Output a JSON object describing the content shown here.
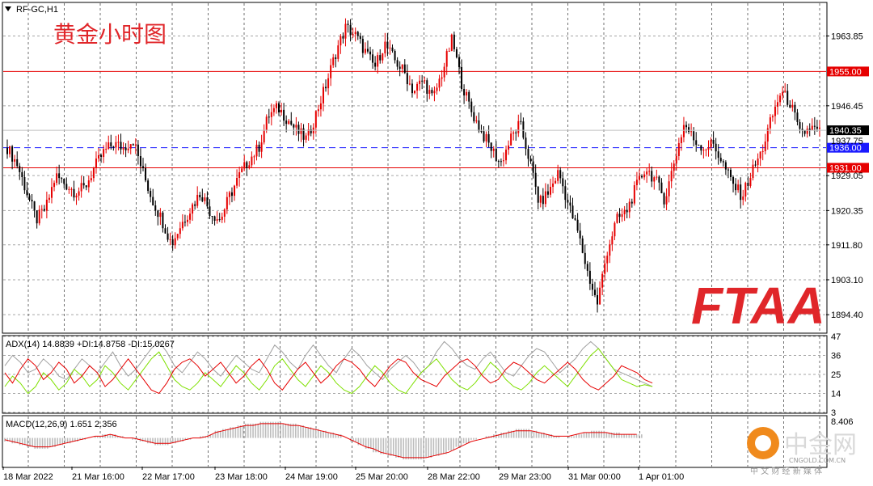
{
  "header": {
    "symbol_label": "RF-GC,H1",
    "chart_title_cn": "黄金小时图",
    "logo_text": "FTAA"
  },
  "watermark": {
    "cn_name": "中金网",
    "domain": "CNGOLD.COM.CN",
    "tagline": "中 文 财 经 新 媒 体"
  },
  "colors": {
    "bull": "#e60000",
    "bear": "#000000",
    "resistance": "#e60000",
    "support_dashed": "#1a1aff",
    "adx": "#a0a0a0",
    "plus_di": "#7fe000",
    "minus_di": "#e60000",
    "macd_hist": "#bdbdbd",
    "macd_signal": "#e60000"
  },
  "chart_data": [
    {
      "type": "candlestick",
      "name": "main",
      "y_axis_ticks": [
        "1963.85",
        "1946.45",
        "1929.05",
        "1920.35",
        "1911.80",
        "1903.10",
        "1894.40"
      ],
      "ylim": [
        1890.0,
        1972.0
      ],
      "x_tick_labels": [
        "18 Mar 2022",
        "21 Mar 16:00",
        "22 Mar 17:00",
        "23 Mar 18:00",
        "24 Mar 19:00",
        "25 Mar 20:00",
        "28 Mar 22:00",
        "29 Mar 23:00",
        "31 Mar 00:00",
        "1 Apr 01:00"
      ],
      "levels": [
        {
          "value": 1955.0,
          "label": "1955.00",
          "style": "solid",
          "color": "#e60000"
        },
        {
          "value": 1936.0,
          "label": "1936.00",
          "style": "dashed",
          "color": "#1a1aff"
        },
        {
          "value": 1931.0,
          "label": "1931.00",
          "style": "solid",
          "color": "#e60000"
        }
      ],
      "current_price": {
        "value": 1940.35,
        "label": "1940.35"
      },
      "extra_label": {
        "value": 1937.75,
        "label": "1937.75"
      },
      "path": [
        1936,
        1932,
        1925,
        1918,
        1921,
        1929,
        1927,
        1925,
        1926,
        1931,
        1935,
        1937,
        1936,
        1938,
        1930,
        1923,
        1918,
        1912,
        1917,
        1921,
        1925,
        1920,
        1918,
        1924,
        1929,
        1933,
        1936,
        1944,
        1946,
        1943,
        1940,
        1938,
        1945,
        1952,
        1960,
        1966,
        1964,
        1960,
        1956,
        1962,
        1958,
        1955,
        1950,
        1953,
        1948,
        1955,
        1963,
        1952,
        1945,
        1940,
        1936,
        1932,
        1938,
        1942,
        1933,
        1922,
        1925,
        1930,
        1922,
        1915,
        1905,
        1897,
        1910,
        1918,
        1920,
        1926,
        1931,
        1928,
        1923,
        1933,
        1942,
        1938,
        1936,
        1937,
        1932,
        1927,
        1924,
        1930,
        1935,
        1943,
        1950,
        1947,
        1939,
        1941,
        1940
      ]
    },
    {
      "type": "line",
      "name": "ADX",
      "label": "ADX(14) 14.8839 +DI:14.8758 -DI:15.0267",
      "y_axis_ticks": [
        "47",
        "36",
        "25",
        "14",
        "3"
      ],
      "ylim": [
        3,
        47
      ],
      "series": [
        {
          "name": "ADX",
          "color": "#a0a0a0",
          "values": [
            30,
            36,
            32,
            26,
            28,
            34,
            30,
            24,
            22,
            28,
            34,
            30,
            26,
            32,
            38,
            30,
            24,
            28,
            34,
            40,
            44,
            38,
            30,
            26,
            32,
            38,
            34,
            28,
            24,
            30,
            36,
            32,
            28,
            26,
            34,
            42,
            38,
            32,
            28,
            36,
            42,
            36,
            30,
            26,
            34,
            40,
            36,
            30,
            26,
            22,
            28,
            32,
            36,
            32,
            26,
            30,
            38,
            44,
            40,
            34,
            30,
            28,
            34,
            38,
            32,
            26,
            24,
            30,
            36,
            40,
            38,
            32,
            26,
            30,
            34,
            40,
            44,
            40,
            34,
            28,
            26,
            24,
            22,
            20,
            18
          ]
        },
        {
          "name": "+DI",
          "color": "#7fe000",
          "values": [
            18,
            24,
            20,
            14,
            18,
            26,
            22,
            16,
            20,
            28,
            24,
            18,
            22,
            30,
            26,
            20,
            16,
            22,
            28,
            34,
            38,
            30,
            22,
            18,
            16,
            20,
            26,
            22,
            18,
            24,
            30,
            26,
            20,
            16,
            22,
            30,
            34,
            28,
            22,
            18,
            24,
            30,
            26,
            20,
            16,
            14,
            18,
            24,
            30,
            26,
            20,
            16,
            14,
            20,
            26,
            30,
            34,
            28,
            22,
            18,
            16,
            20,
            26,
            32,
            28,
            22,
            18,
            16,
            20,
            26,
            30,
            26,
            22,
            18,
            24,
            30,
            36,
            40,
            34,
            28,
            22,
            20,
            18,
            19,
            18
          ]
        },
        {
          "name": "-DI",
          "color": "#e60000",
          "values": [
            26,
            20,
            28,
            34,
            30,
            22,
            26,
            32,
            28,
            20,
            24,
            30,
            26,
            18,
            22,
            28,
            34,
            28,
            22,
            16,
            14,
            20,
            28,
            32,
            34,
            30,
            24,
            28,
            32,
            26,
            20,
            24,
            30,
            34,
            28,
            20,
            16,
            22,
            28,
            32,
            26,
            20,
            24,
            30,
            34,
            32,
            28,
            22,
            18,
            24,
            30,
            34,
            32,
            26,
            22,
            20,
            18,
            24,
            28,
            32,
            34,
            30,
            24,
            20,
            22,
            28,
            32,
            30,
            26,
            22,
            20,
            24,
            28,
            32,
            28,
            22,
            18,
            16,
            20,
            24,
            30,
            28,
            26,
            22,
            20
          ]
        }
      ]
    },
    {
      "type": "bar",
      "name": "MACD",
      "label": "MACD(12,26,9) 1.651 2.356",
      "y_axis_ticks": [
        "8.406"
      ],
      "ylim": [
        -16,
        12
      ],
      "histogram": [
        -2,
        -3,
        -4,
        -5,
        -6,
        -6,
        -5,
        -4,
        -3,
        -2,
        -1,
        0,
        1,
        2,
        2,
        1,
        0,
        -1,
        -2,
        -3,
        -4,
        -4,
        -3,
        -2,
        -1,
        0,
        1,
        2,
        4,
        5,
        6,
        7,
        8,
        8,
        9,
        9,
        9,
        8,
        8,
        7,
        6,
        5,
        4,
        3,
        2,
        0,
        -2,
        -4,
        -6,
        -8,
        -9,
        -10,
        -11,
        -12,
        -12,
        -12,
        -11,
        -10,
        -9,
        -7,
        -5,
        -3,
        -1,
        0,
        1,
        2,
        3,
        4,
        5,
        5,
        4,
        3,
        2,
        1,
        0,
        1,
        2,
        3,
        4,
        4,
        3,
        3,
        2,
        2,
        2
      ],
      "signal": [
        -1,
        -2,
        -3,
        -4,
        -5,
        -5,
        -5,
        -4,
        -3,
        -2,
        -1,
        0,
        1,
        1,
        2,
        1,
        0,
        0,
        -1,
        -2,
        -3,
        -3,
        -3,
        -2,
        -1,
        0,
        0,
        1,
        3,
        4,
        5,
        6,
        7,
        7,
        8,
        8,
        8,
        8,
        7,
        7,
        6,
        5,
        4,
        3,
        2,
        1,
        -1,
        -3,
        -5,
        -6,
        -8,
        -9,
        -10,
        -11,
        -11,
        -11,
        -11,
        -10,
        -9,
        -8,
        -6,
        -4,
        -2,
        -1,
        0,
        1,
        2,
        3,
        4,
        4,
        4,
        3,
        2,
        1,
        1,
        1,
        2,
        3,
        3,
        3,
        3,
        2,
        2,
        2,
        2
      ]
    }
  ]
}
